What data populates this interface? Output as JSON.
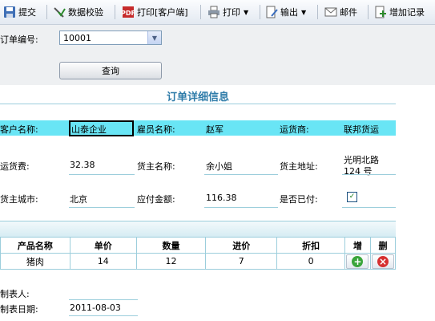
{
  "toolbar": {
    "submit": "提交",
    "validate": "数据校验",
    "print_client": "打印[客户端]",
    "print": "打印",
    "export": "输出",
    "mail": "邮件",
    "add_record": "增加记录"
  },
  "query": {
    "order_no_label": "订单编号:",
    "order_no_value": "10001",
    "query_button": "查询"
  },
  "form": {
    "title": "订单详细信息",
    "customer_name_label": "客户名称:",
    "customer_name": "山泰企业",
    "employee_name_label": "雇员名称:",
    "employee_name": "赵军",
    "shipper_label": "运货商:",
    "shipper": "联邦货运",
    "freight_label": "运货费:",
    "freight": "32.38",
    "consignee_name_label": "货主名称:",
    "consignee_name": "余小姐",
    "consignee_address_label": "货主地址:",
    "consignee_address_line1": "光明北路",
    "consignee_address_line2": "124 号",
    "consignee_city_label": "货主城市:",
    "consignee_city": "北京",
    "amount_due_label": "应付金额:",
    "amount_due": "116.38",
    "paid_label": "是否已付:",
    "paid": true
  },
  "grid": {
    "headers": [
      "产品名称",
      "单价",
      "数量",
      "进价",
      "折扣",
      "增",
      "删"
    ],
    "rows": [
      {
        "product": "猪肉",
        "unit_price": "14",
        "quantity": "12",
        "cost": "7",
        "discount": "0"
      }
    ]
  },
  "footer": {
    "maker_label": "制表人:",
    "maker": "",
    "date_label": "制表日期:",
    "date": "2011-08-03"
  },
  "colors": {
    "highlight_row": "#69e5f5",
    "title": "#2f7ca9",
    "line": "#9ccedc"
  },
  "icons": {
    "submit": "floppy-disk-icon",
    "validate": "check-wand-icon",
    "print_client": "pdf-icon",
    "print": "printer-icon",
    "export": "document-pen-icon",
    "mail": "envelope-icon",
    "add_record": "add-record-icon",
    "row_add": "plus-circle-icon",
    "row_delete": "x-circle-icon"
  }
}
